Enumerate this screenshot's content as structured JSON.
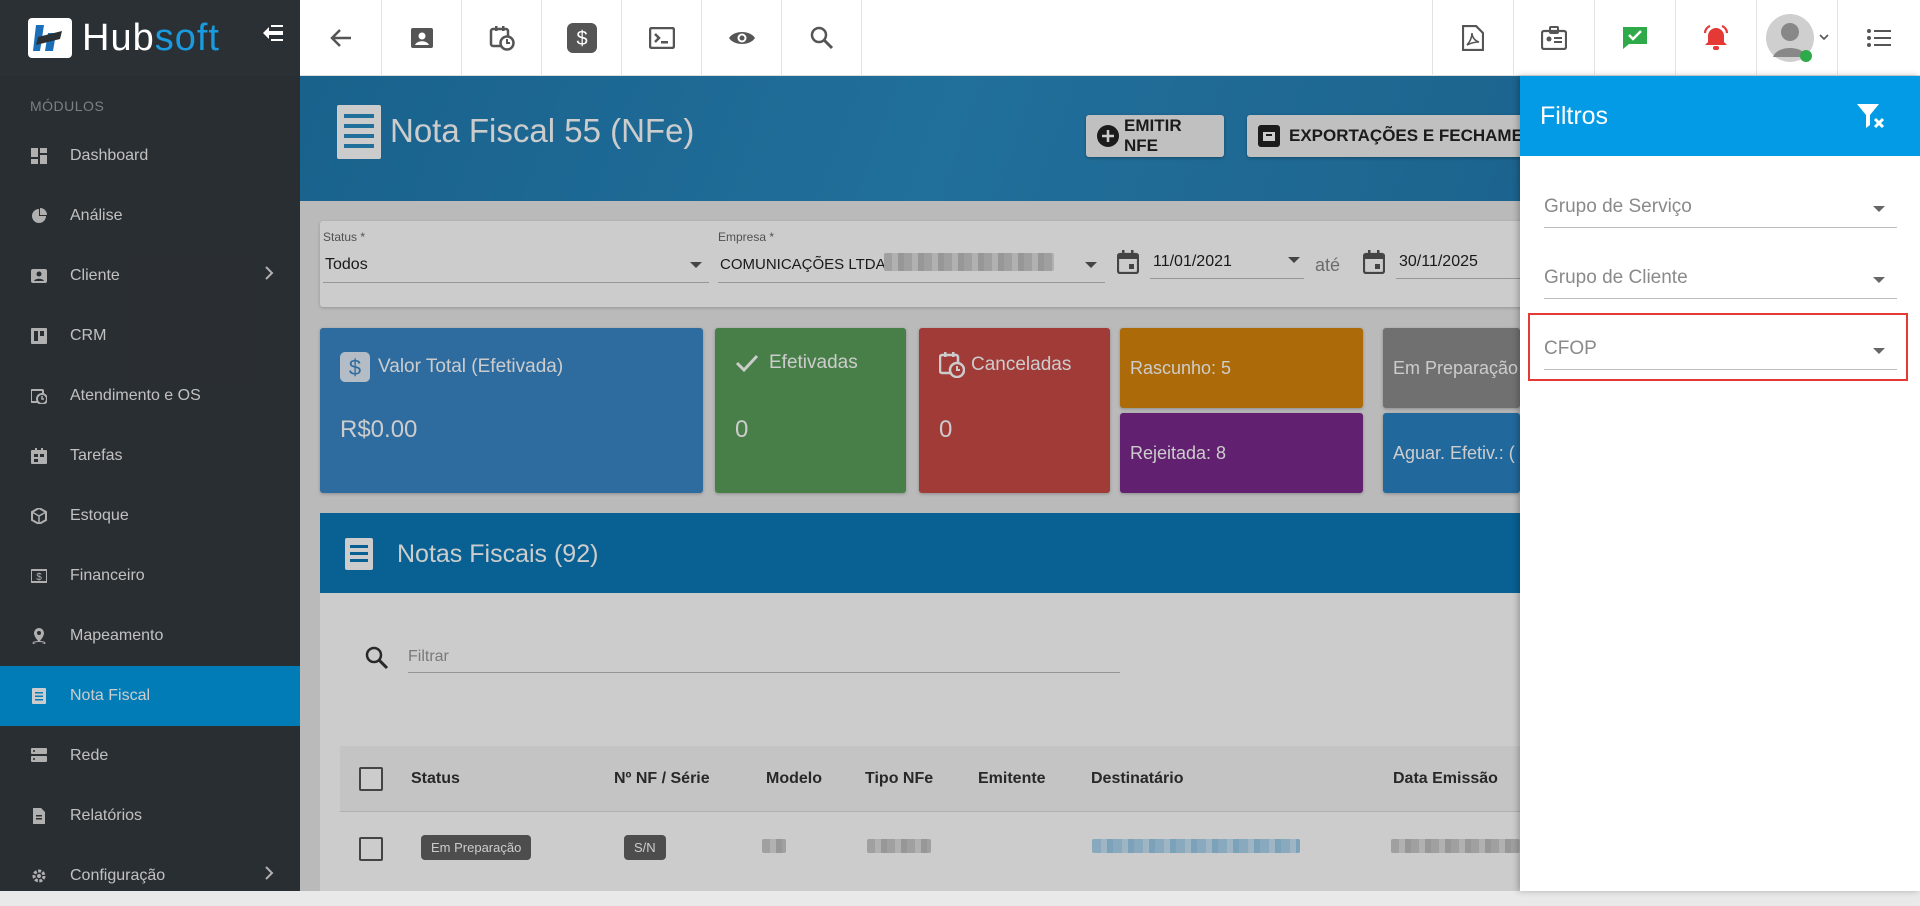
{
  "app": {
    "brand_part1": "Hub",
    "brand_part2": "soft"
  },
  "sidebar": {
    "section_label": "MÓDULOS",
    "items": [
      {
        "label": "Dashboard",
        "icon": "dashboard-icon"
      },
      {
        "label": "Análise",
        "icon": "pie-chart-icon"
      },
      {
        "label": "Cliente",
        "icon": "contact-icon",
        "has_submenu": true
      },
      {
        "label": "CRM",
        "icon": "crm-icon"
      },
      {
        "label": "Atendimento e OS",
        "icon": "calendar-clock-icon"
      },
      {
        "label": "Tarefas",
        "icon": "tasks-icon"
      },
      {
        "label": "Estoque",
        "icon": "package-icon"
      },
      {
        "label": "Financeiro",
        "icon": "money-icon"
      },
      {
        "label": "Mapeamento",
        "icon": "map-pin-icon"
      },
      {
        "label": "Nota Fiscal",
        "icon": "receipt-icon",
        "active": true
      },
      {
        "label": "Rede",
        "icon": "server-icon"
      },
      {
        "label": "Relatórios",
        "icon": "report-icon"
      },
      {
        "label": "Configuração",
        "icon": "gear-icon",
        "has_submenu": true
      }
    ]
  },
  "topbar": {
    "left_icons": [
      "back-arrow-icon",
      "contact-card-icon",
      "calendar-clock-icon",
      "dollar-icon",
      "terminal-icon",
      "eye-icon",
      "search-icon"
    ],
    "right_icons": [
      "pdf-icon",
      "badge-icon",
      "chat-check-icon",
      "alarm-icon",
      "avatar",
      "list-icon"
    ]
  },
  "header": {
    "title": "Nota Fiscal 55 (NFe)",
    "emit_button": "EMITIR NFE",
    "export_button": "EXPORTAÇÕES E FECHAMEN"
  },
  "filters": {
    "status_label": "Status *",
    "status_value": "Todos",
    "empresa_label": "Empresa *",
    "empresa_value": "COMUNICAÇÕES LTDA",
    "date_from": "11/01/2021",
    "date_sep": "até",
    "date_to": "30/11/2025"
  },
  "cards": {
    "valor_total": {
      "title": "Valor Total (Efetivada)",
      "value": "R$0.00",
      "color": "#3a87c8"
    },
    "efetivadas": {
      "title": "Efetivadas",
      "value": "0",
      "color": "#5a9e5a"
    },
    "canceladas": {
      "title": "Canceladas",
      "value": "0",
      "color": "#c84a47"
    },
    "rascunho": {
      "label": "Rascunho: 5",
      "color": "#d8860a"
    },
    "rejeitada": {
      "label": "Rejeitada: 8",
      "color": "#7b2a8c"
    },
    "em_preparacao": {
      "label": "Em Preparação",
      "color": "#8c8c8c"
    },
    "aguar_efetiv": {
      "label": "Aguar. Efetiv.: (",
      "color": "#2a82c4"
    }
  },
  "notas": {
    "title": "Notas Fiscais (92)",
    "filter_placeholder": "Filtrar",
    "columns": [
      "Status",
      "Nº NF / Série",
      "Modelo",
      "Tipo NFe",
      "Emitente",
      "Destinatário",
      "Data Emissão"
    ],
    "rows": [
      {
        "status": "Em Preparação",
        "nf_serie": "S/N"
      }
    ]
  },
  "filtros_panel": {
    "title": "Filtros",
    "fields": [
      "Grupo de Serviço",
      "Grupo de Cliente",
      "CFOP"
    ]
  },
  "colors": {
    "sidebar_bg": "#343a40",
    "accent": "#039be5",
    "highlight": "#e53935"
  }
}
